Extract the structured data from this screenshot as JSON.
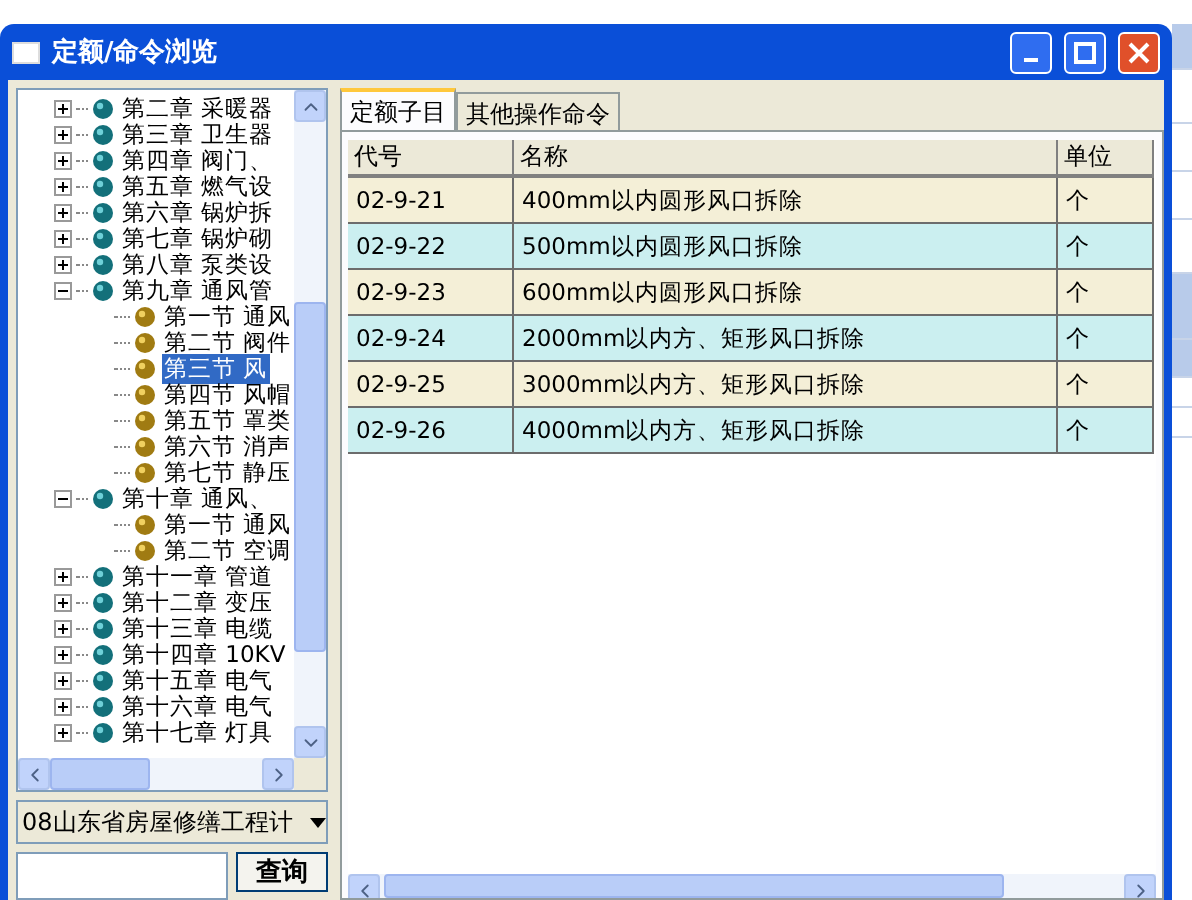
{
  "window": {
    "title": "定额/命令浏览"
  },
  "tree": [
    {
      "label": "第二章 采暖器",
      "expanded": false
    },
    {
      "label": "第三章 卫生器",
      "expanded": false
    },
    {
      "label": "第四章 阀门、",
      "expanded": false
    },
    {
      "label": "第五章 燃气设",
      "expanded": false
    },
    {
      "label": "第六章 锅炉拆",
      "expanded": false
    },
    {
      "label": "第七章 锅炉砌",
      "expanded": false
    },
    {
      "label": "第八章 泵类设",
      "expanded": false
    },
    {
      "label": "第九章 通风管",
      "expanded": true,
      "children": [
        {
          "label": "第一节 通风",
          "selected": false
        },
        {
          "label": "第二节 阀件",
          "selected": false
        },
        {
          "label": "第三节 风",
          "selected": true
        },
        {
          "label": "第四节 风帽",
          "selected": false
        },
        {
          "label": "第五节 罩类",
          "selected": false
        },
        {
          "label": "第六节 消声",
          "selected": false
        },
        {
          "label": "第七节 静压",
          "selected": false
        }
      ]
    },
    {
      "label": "第十章 通风、",
      "expanded": true,
      "children": [
        {
          "label": "第一节 通风",
          "selected": false
        },
        {
          "label": "第二节 空调",
          "selected": false
        }
      ]
    },
    {
      "label": "第十一章 管道",
      "expanded": false
    },
    {
      "label": "第十二章 变压",
      "expanded": false
    },
    {
      "label": "第十三章 电缆",
      "expanded": false
    },
    {
      "label": "第十四章 10KV",
      "expanded": false
    },
    {
      "label": "第十五章 电气",
      "expanded": false
    },
    {
      "label": "第十六章 电气",
      "expanded": false
    },
    {
      "label": "第十七章 灯具",
      "expanded": false
    }
  ],
  "library_select": {
    "value": "08山东省房屋修缮工程计"
  },
  "query_button": "查询",
  "tabs": [
    {
      "label": "定额子目",
      "selected": true
    },
    {
      "label": "其他操作命令",
      "selected": false
    }
  ],
  "table": {
    "columns": [
      "代号",
      "名称",
      "单位"
    ],
    "rows": [
      [
        "02-9-21",
        "400mm以内圆形风口拆除",
        "个"
      ],
      [
        "02-9-22",
        "500mm以内圆形风口拆除",
        "个"
      ],
      [
        "02-9-23",
        "600mm以内圆形风口拆除",
        "个"
      ],
      [
        "02-9-24",
        "2000mm以内方、矩形风口拆除",
        "个"
      ],
      [
        "02-9-25",
        "3000mm以内方、矩形风口拆除",
        "个"
      ],
      [
        "02-9-26",
        "4000mm以内方、矩形风口拆除",
        "个"
      ]
    ]
  }
}
